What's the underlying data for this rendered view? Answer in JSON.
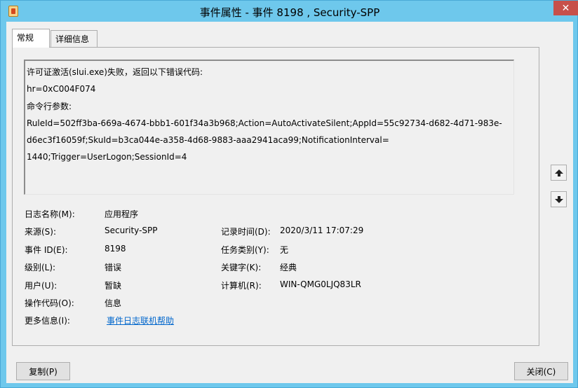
{
  "window": {
    "title": "事件属性 - 事件 8198 , Security-SPP",
    "close_label": "✕"
  },
  "tabs": [
    {
      "label": "常规",
      "active": true
    },
    {
      "label": "详细信息",
      "active": false
    }
  ],
  "description": {
    "lines": [
      "许可证激活(slui.exe)失败，返回以下错误代码:",
      "hr=0xC004F074",
      "命令行参数:",
      "RuleId=502ff3ba-669a-4674-bbb1-601f34a3b968;Action=AutoActivateSilent;AppId=55c92734-d682-4d71-983e-",
      "d6ec3f16059f;SkuId=b3ca044e-a358-4d68-9883-aaa2941aca99;NotificationInterval=",
      "1440;Trigger=UserLogon;SessionId=4"
    ]
  },
  "fields": {
    "log_name_label": "日志名称(M):",
    "log_name_value": "应用程序",
    "source_label": "来源(S):",
    "source_value": "Security-SPP",
    "logged_label": "记录时间(D):",
    "logged_value": "2020/3/11 17:07:29",
    "event_id_label": "事件 ID(E):",
    "event_id_value": "8198",
    "task_category_label": "任务类别(Y):",
    "task_category_value": "无",
    "level_label": "级别(L):",
    "level_value": "错误",
    "keywords_label": "关键字(K):",
    "keywords_value": "经典",
    "user_label": "用户(U):",
    "user_value": "暂缺",
    "computer_label": "计算机(R):",
    "computer_value": "WIN-QMG0LJQ83LR",
    "opcode_label": "操作代码(O):",
    "opcode_value": "信息",
    "more_info_label": "更多信息(I):",
    "more_info_link": "事件日志联机帮助"
  },
  "buttons": {
    "copy_label": "复制(P)",
    "close_label": "关闭(C)"
  }
}
